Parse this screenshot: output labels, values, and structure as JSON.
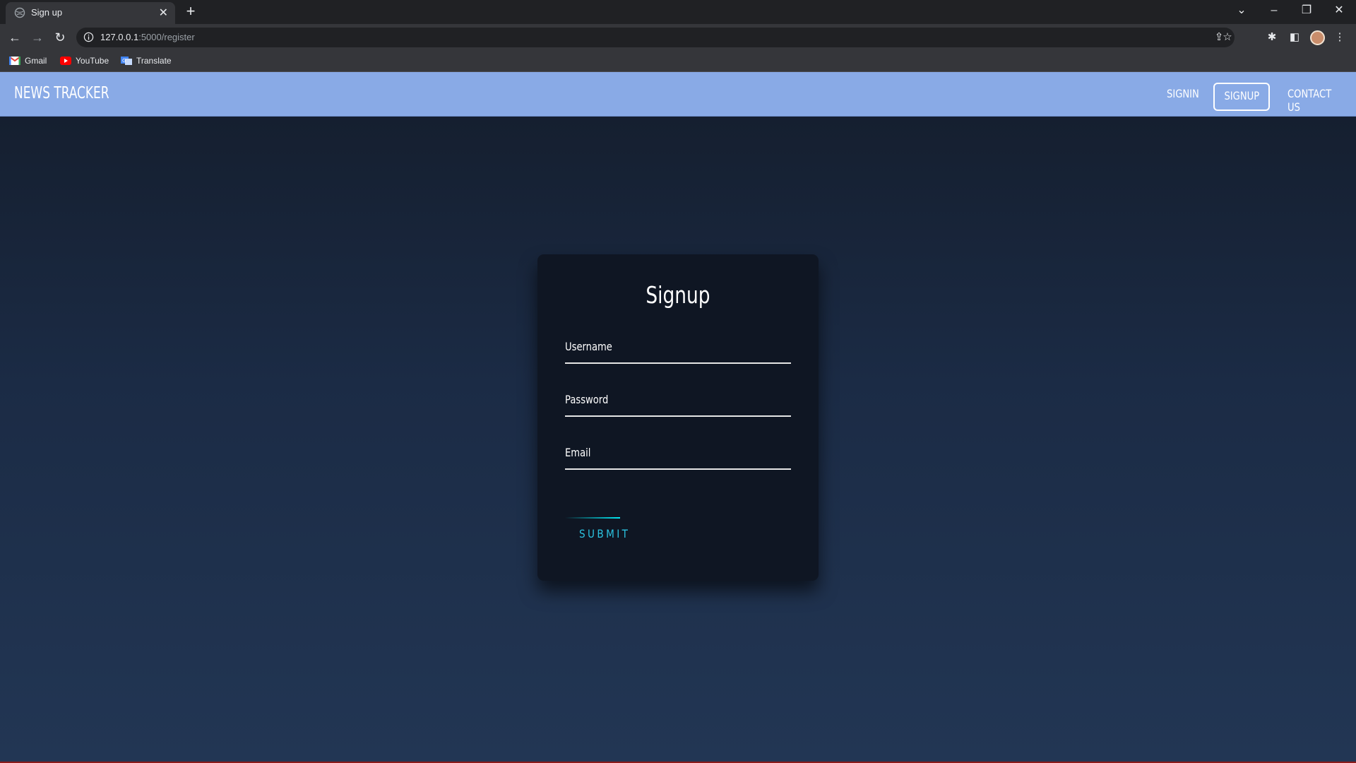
{
  "browser": {
    "tab_title": "Sign up",
    "url_host": "127.0.0.1",
    "url_rest": ":5000/register",
    "bookmarks": [
      "Gmail",
      "YouTube",
      "Translate"
    ]
  },
  "site": {
    "brand": "NEWS TRACKER",
    "nav": {
      "signin": "SIGNIN",
      "signup": "SIGNUP",
      "contact": "CONTACT US"
    }
  },
  "form": {
    "title": "Signup",
    "username_label": "Username",
    "password_label": "Password",
    "email_label": "Email",
    "submit_label": "SUBMIT"
  },
  "colors": {
    "nav_bg": "#89aae6",
    "card_bg": "#0f1623",
    "submit_accent": "#03e9f4"
  }
}
